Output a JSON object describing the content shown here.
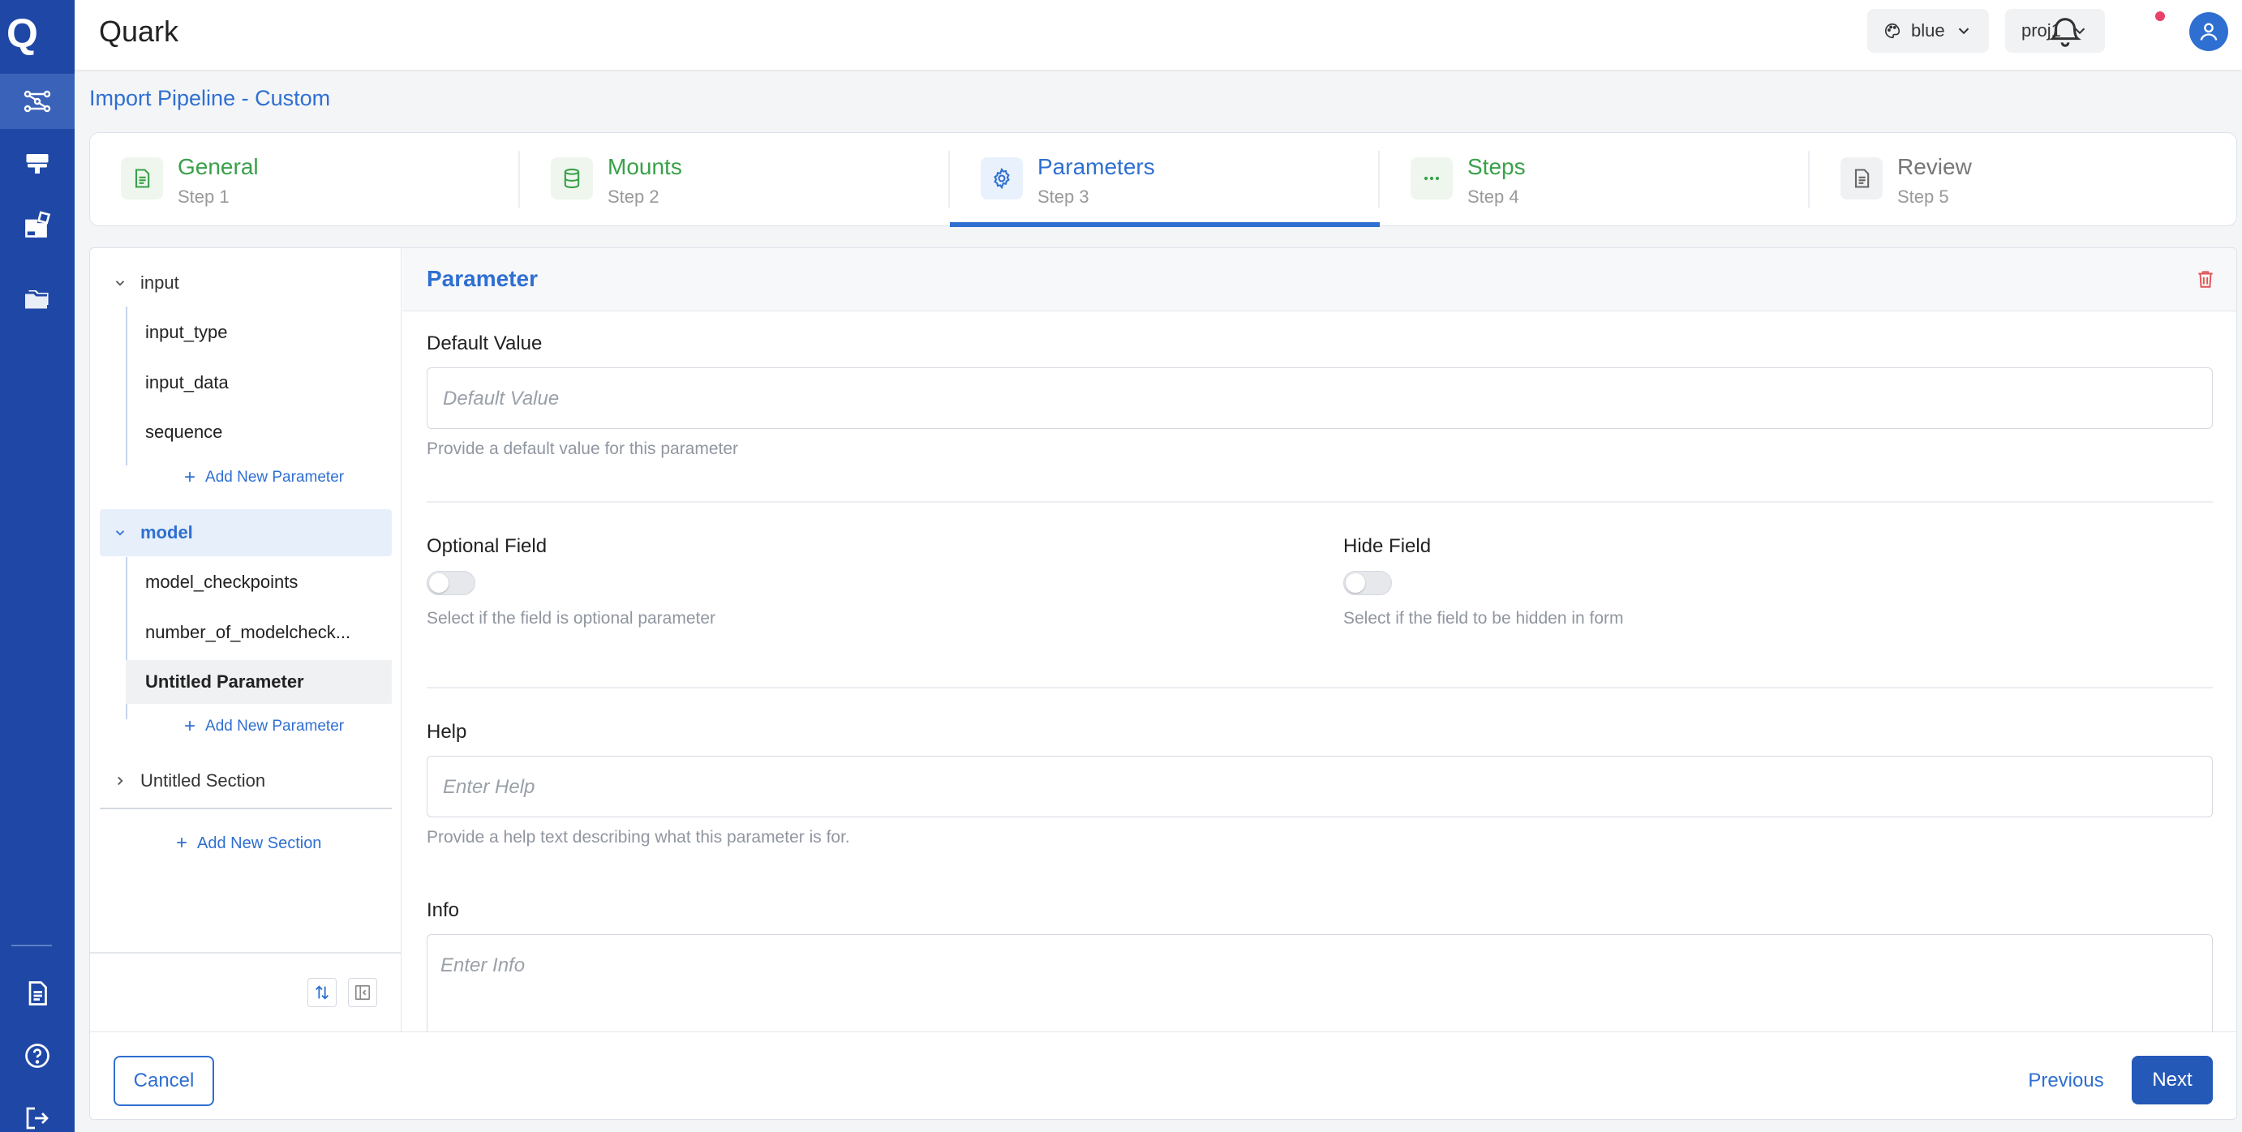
{
  "app": {
    "title": "Quark",
    "logo_letter": "Q"
  },
  "topbar": {
    "theme_label": "blue",
    "project_label": "proj1"
  },
  "sidebar": {
    "items": [
      {
        "icon": "pipeline-icon",
        "active": true
      },
      {
        "icon": "compute-icon",
        "active": false
      },
      {
        "icon": "apps-icon",
        "active": false
      },
      {
        "icon": "folder-icon",
        "active": false
      }
    ],
    "bottom_items": [
      {
        "icon": "document-icon"
      },
      {
        "icon": "help-icon"
      },
      {
        "icon": "logout-icon"
      }
    ]
  },
  "page": {
    "heading": "Import Pipeline - Custom"
  },
  "stepper": {
    "steps": [
      {
        "title": "General",
        "sub": "Step 1",
        "state": "done",
        "icon": "document-icon"
      },
      {
        "title": "Mounts",
        "sub": "Step 2",
        "state": "done",
        "icon": "database-icon"
      },
      {
        "title": "Parameters",
        "sub": "Step 3",
        "state": "current",
        "icon": "gear-icon"
      },
      {
        "title": "Steps",
        "sub": "Step 4",
        "state": "done",
        "icon": "ellipsis-icon"
      },
      {
        "title": "Review",
        "sub": "Step 5",
        "state": "pending",
        "icon": "document-icon"
      }
    ]
  },
  "tree": {
    "sections": [
      {
        "label": "input",
        "expanded": true,
        "selected": false,
        "items": [
          "input_type",
          "input_data",
          "sequence"
        ],
        "add_label": "Add New Parameter"
      },
      {
        "label": "model",
        "expanded": true,
        "selected": true,
        "items": [
          "model_checkpoints",
          "number_of_modelcheck...",
          "Untitled Parameter"
        ],
        "selected_item": "Untitled Parameter",
        "add_label": "Add New Parameter"
      },
      {
        "label": "Untitled Section",
        "expanded": false,
        "selected": false
      }
    ],
    "add_section_label": "Add New Section"
  },
  "form": {
    "title": "Parameter",
    "default_value": {
      "label": "Default Value",
      "placeholder": "Default Value",
      "help": "Provide a default value for this parameter"
    },
    "optional_field": {
      "label": "Optional Field",
      "checked": false,
      "help": "Select if the field is optional parameter"
    },
    "hide_field": {
      "label": "Hide Field",
      "checked": false,
      "help": "Select if the field to be hidden in form"
    },
    "help_field": {
      "label": "Help",
      "placeholder": "Enter Help",
      "help": "Provide a help text describing what this parameter is for."
    },
    "info_field": {
      "label": "Info",
      "placeholder": "Enter Info"
    }
  },
  "footer": {
    "cancel_label": "Cancel",
    "previous_label": "Previous",
    "next_label": "Next"
  },
  "colors": {
    "sidebar": "#1f48a6",
    "accent": "#2f6fd1",
    "success": "#3aa04a",
    "danger": "#e05555"
  }
}
